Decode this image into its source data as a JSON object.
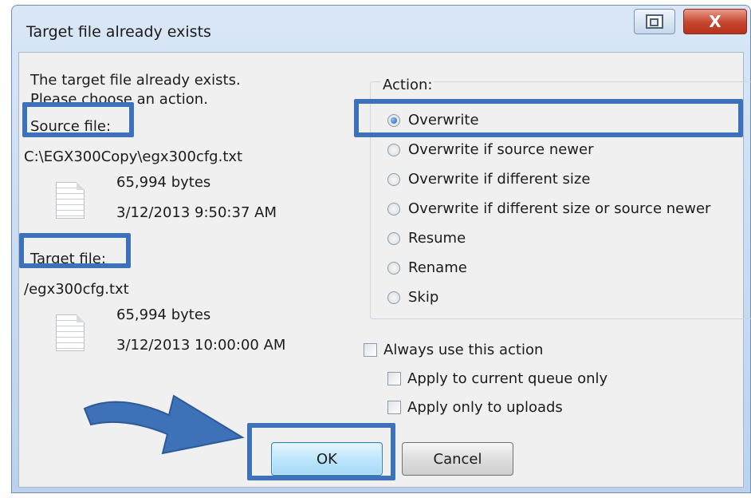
{
  "window": {
    "title": "Target file already exists",
    "close_glyph": "X"
  },
  "message": {
    "line1": "The target file already exists.",
    "line2": "Please choose an action."
  },
  "source": {
    "label": "Source file:",
    "path": "C:\\EGX300Copy\\egx300cfg.txt",
    "size": "65,994 bytes",
    "date": "3/12/2013 9:50:37 AM"
  },
  "target": {
    "label": "Target file:",
    "path": "/egx300cfg.txt",
    "size": "65,994 bytes",
    "date": "3/12/2013 10:00:00 AM"
  },
  "action": {
    "label": "Action:",
    "options": [
      {
        "label": "Overwrite",
        "checked": true
      },
      {
        "label": "Overwrite if source newer",
        "checked": false
      },
      {
        "label": "Overwrite if different size",
        "checked": false
      },
      {
        "label": "Overwrite if different size or source newer",
        "checked": false
      },
      {
        "label": "Resume",
        "checked": false
      },
      {
        "label": "Rename",
        "checked": false
      },
      {
        "label": "Skip",
        "checked": false
      }
    ]
  },
  "checks": {
    "always": "Always use this action",
    "current_queue": "Apply to current queue only",
    "uploads": "Apply only to uploads"
  },
  "buttons": {
    "ok": "OK",
    "cancel": "Cancel"
  },
  "colors": {
    "highlight": "#3d72b8",
    "default_button": "#bee6fd",
    "close_button": "#c5452e"
  }
}
